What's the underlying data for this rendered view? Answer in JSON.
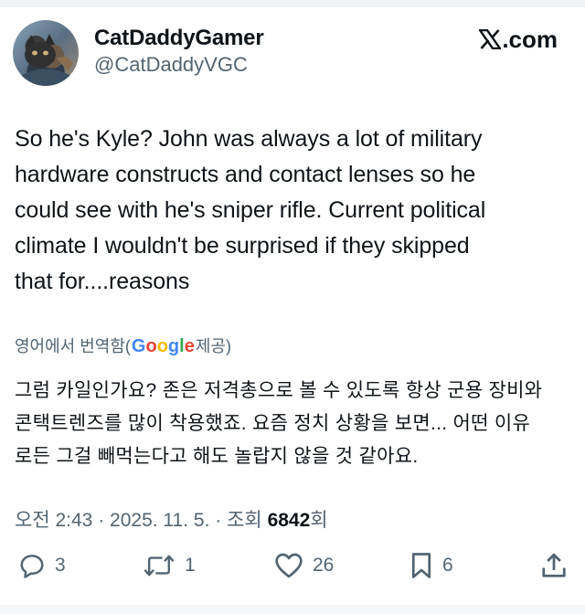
{
  "author": {
    "display_name": "CatDaddyGamer",
    "handle": "@CatDaddyVGC"
  },
  "brand": {
    "label": ".com",
    "icon": "x-logo-icon"
  },
  "tweet": {
    "lines": [
      "So he's Kyle? John was always a lot of military",
      "hardware constructs and contact lenses so he",
      "could see with he's sniper rifle. Current political",
      "climate I wouldn't be surprised if they skipped",
      "that for....reasons"
    ]
  },
  "translation": {
    "prefix": "영어에서 번역함(",
    "provider": [
      "G",
      "o",
      "o",
      "g",
      "l",
      "e"
    ],
    "suffix": " 제공)",
    "lines": [
      "그럼 카일인가요? 존은 저격총으로 볼 수 있도록 항상 군용 장비와",
      "콘택트렌즈를 많이 착용했죠. 요즘 정치 상황을 보면... 어떤 이유",
      "로든 그걸 빼먹는다고 해도 놀랍지 않을 것 같아요."
    ]
  },
  "meta": {
    "time": "오전 2:43",
    "sep1": " · ",
    "date": "2025. 11. 5.",
    "sep2": " · ",
    "views_label": "조회 ",
    "views_count": "6842",
    "views_suffix": "회"
  },
  "actions": {
    "reply": {
      "count": "3",
      "icon": "reply-icon"
    },
    "retweet": {
      "count": "1",
      "icon": "retweet-icon"
    },
    "like": {
      "count": "26",
      "icon": "heart-icon"
    },
    "bookmark": {
      "count": "6",
      "icon": "bookmark-icon"
    },
    "share": {
      "icon": "share-icon"
    }
  },
  "colors": {
    "text": "#0f1419",
    "secondary": "#536471"
  }
}
